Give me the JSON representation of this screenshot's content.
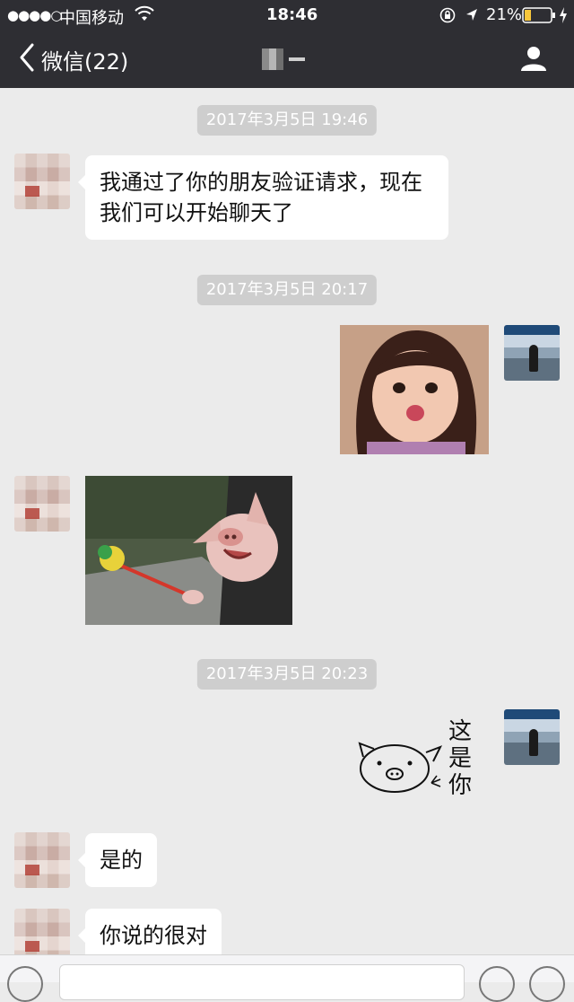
{
  "status_bar": {
    "signal": "●●●●○",
    "carrier": "中国移动",
    "time": "18:46",
    "battery": "21%"
  },
  "nav": {
    "back_label": "微信(22)",
    "contact_name": ""
  },
  "messages": {
    "ts1": "2017年3月5日 19:46",
    "m1": "我通过了你的朋友验证请求，现在我们可以开始聊天了",
    "ts2": "2017年3月5日 20:17",
    "ts3": "2017年3月5日 20:23",
    "sticker_text": "这是你",
    "m2": "是的",
    "m3": "你说的很对"
  },
  "colors": {
    "nav_bg": "#2e2e33",
    "chat_bg": "#ebebeb",
    "timestamp_bg": "#cecece",
    "bubble_bg": "#ffffff",
    "battery_fill": "#f7c63b"
  },
  "icons": [
    "wifi-icon",
    "lock-rotation-icon",
    "location-arrow-icon",
    "battery-icon",
    "charging-icon",
    "back-chevron-icon",
    "contact-profile-icon",
    "voice-icon",
    "emoji-icon",
    "plus-icon"
  ]
}
